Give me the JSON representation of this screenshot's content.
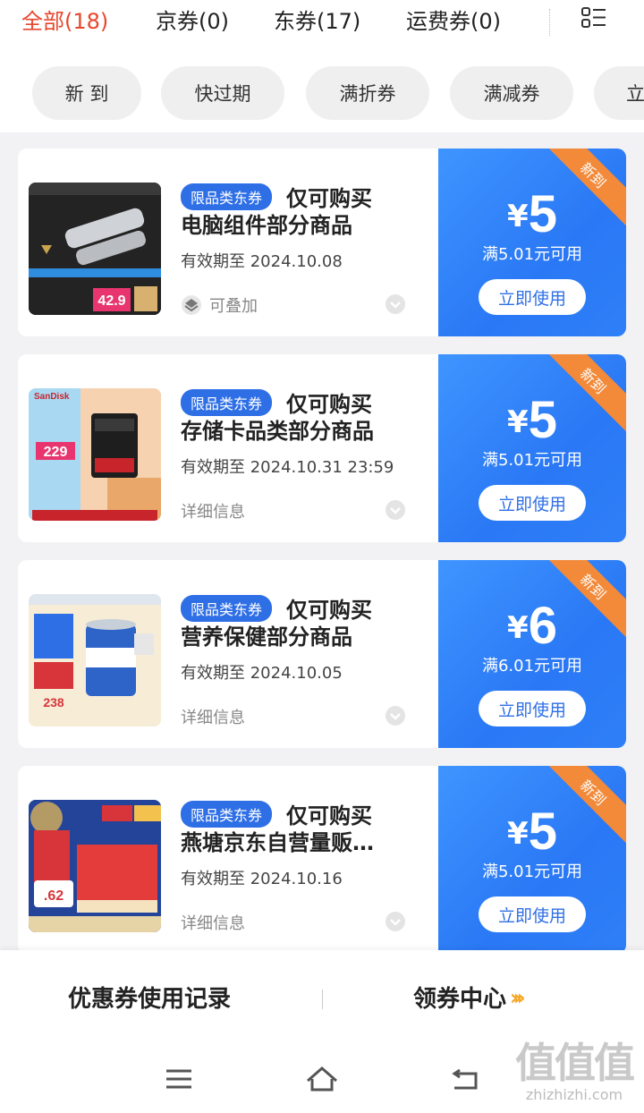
{
  "tabs": {
    "items": [
      {
        "label": "全部(18)",
        "active": true
      },
      {
        "label": "京券(0)",
        "active": false
      },
      {
        "label": "东券(17)",
        "active": false
      },
      {
        "label": "运费券(0)",
        "active": false
      }
    ],
    "menu_icon": "grid-list-icon"
  },
  "filters": [
    "新 到",
    "快过期",
    "满折券",
    "满减券",
    "立"
  ],
  "coupons": [
    {
      "tag": "限品类东券",
      "title_line1": "仅可购买",
      "title_line2": "电脑组件部分商品",
      "expiry": "有效期至 2024.10.08",
      "detail": "可叠加",
      "yen": "¥",
      "amount": "5",
      "condition": "满5.01元可用",
      "button": "立即使用",
      "ribbon": "新到"
    },
    {
      "tag": "限品类东券",
      "title_line1": "仅可购买",
      "title_line2": "存储卡品类部分商品",
      "expiry": "有效期至 2024.10.31 23:59",
      "detail": "详细信息",
      "yen": "¥",
      "amount": "5",
      "condition": "满5.01元可用",
      "button": "立即使用",
      "ribbon": "新到"
    },
    {
      "tag": "限品类东券",
      "title_line1": "仅可购买",
      "title_line2": "营养保健部分商品",
      "expiry": "有效期至 2024.10.05",
      "detail": "详细信息",
      "yen": "¥",
      "amount": "6",
      "condition": "满6.01元可用",
      "button": "立即使用",
      "ribbon": "新到"
    },
    {
      "tag": "限品类东券",
      "title_line1": "仅可购买",
      "title_line2": "燕塘京东自营量贩…",
      "expiry": "有效期至 2024.10.16",
      "detail": "详细信息",
      "yen": "¥",
      "amount": "5",
      "condition": "满5.01元可用",
      "button": "立即使用",
      "ribbon": "新到"
    }
  ],
  "thumb_texts": {
    "usb_price": "42.9",
    "sd_price": "229",
    "sd_brand": "SanDisk",
    "milk_price": "238",
    "yt_price": ".62"
  },
  "bottom": {
    "record": "优惠券使用记录",
    "center": "领券中心",
    "arrows": "›››"
  },
  "watermark": {
    "logo": "值值值",
    "site": "zhizhizhi.com"
  },
  "colors": {
    "accent_red": "#e8462c",
    "coupon_blue": "#2f7ff8",
    "tag_blue": "#2f6fe6",
    "ribbon_orange": "#f28a3a",
    "arrow_yellow": "#f5a623"
  }
}
